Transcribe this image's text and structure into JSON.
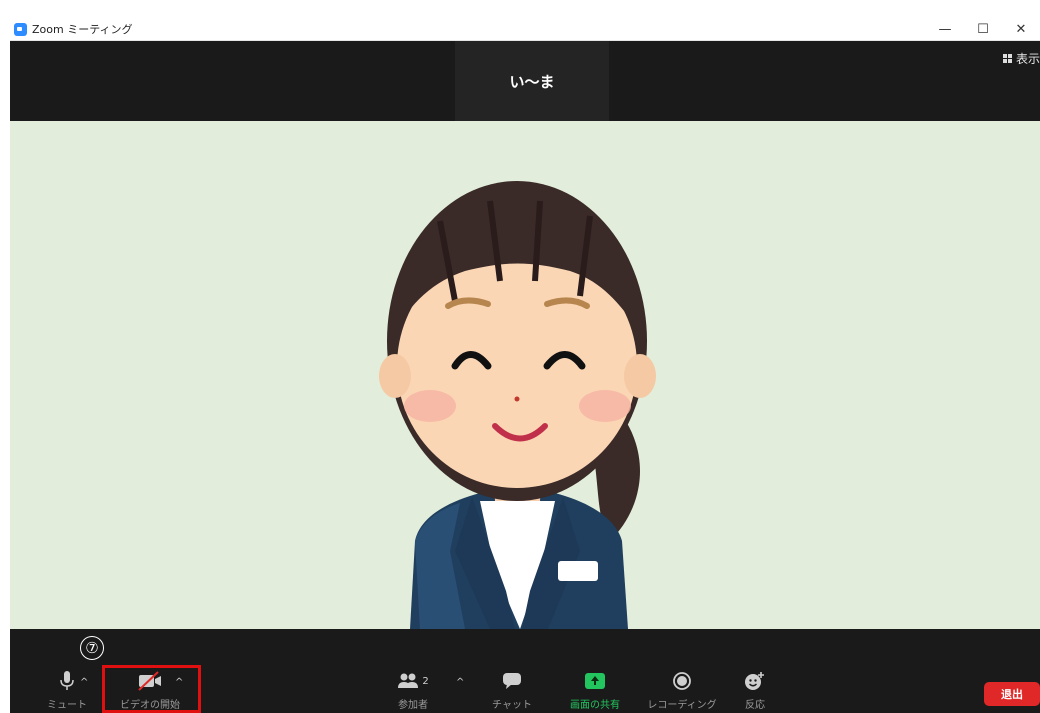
{
  "window": {
    "title": "Zoom ミーティング",
    "controls": {
      "minimize": "—",
      "maximize": "☐",
      "close": "✕"
    }
  },
  "meeting": {
    "participant_name": "い〜ま",
    "view_label": "表示"
  },
  "toolbar": {
    "mute_label": "ミュート",
    "video_label": "ビデオの開始",
    "participants_label": "参加者",
    "participants_count": "2",
    "chat_label": "チャット",
    "share_label": "画面の共有",
    "record_label": "レコーディング",
    "reactions_label": "反応",
    "leave_label": "退出",
    "caret": "^"
  },
  "annotation": {
    "step_marker": "⑦"
  },
  "colors": {
    "toolbar_bg": "#1a1a1a",
    "video_bg": "#e2eedb",
    "share_green": "#22c55e",
    "leave_red": "#e02828",
    "highlight_red": "#e01010",
    "zoom_blue": "#2d8cff"
  }
}
